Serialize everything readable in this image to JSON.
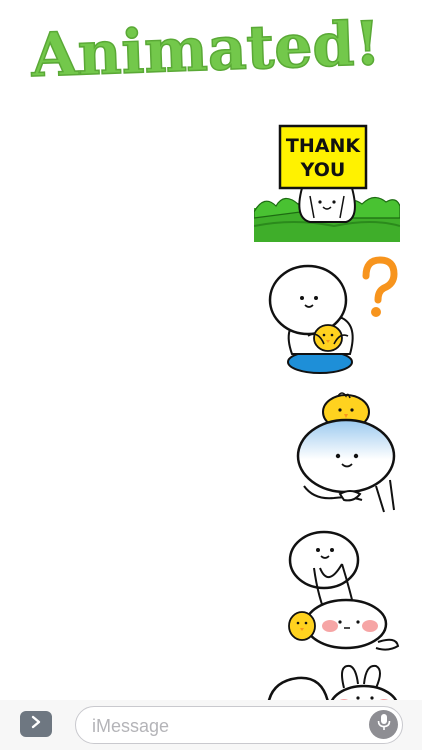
{
  "header": {
    "title": "Animated!",
    "title_color": "#73c84b"
  },
  "stickers": [
    {
      "name": "thank-you-sticker",
      "sign_text": [
        "THANK",
        "YOU"
      ],
      "sign_color": "#fff200",
      "grass_color": "#3fae2a"
    },
    {
      "name": "question-mark-sticker",
      "accent_color": "#f7941d",
      "cushion_color": "#1e8fd8"
    },
    {
      "name": "chick-on-head-sticker",
      "chick_color": "#ffd21f"
    },
    {
      "name": "bunny-hug-sticker",
      "cheek_color": "#f6a5a5"
    },
    {
      "name": "bunny-peek-sticker"
    }
  ],
  "composer": {
    "placeholder": "iMessage",
    "expand_icon": "chevron-right-icon",
    "mic_icon": "microphone-icon"
  }
}
